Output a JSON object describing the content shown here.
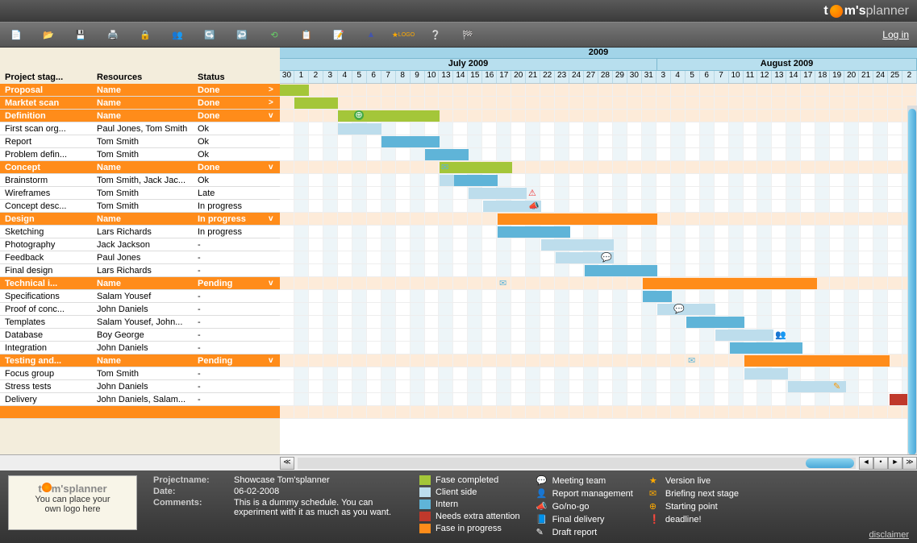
{
  "brand": {
    "t1": "t",
    "t2": "m's",
    "planner": "planner"
  },
  "login": "Log in",
  "toolbarStarLabel": "LOGO",
  "columns": {
    "stage": "Project stag...",
    "resources": "Resources",
    "status": "Status"
  },
  "year": "2009",
  "months": {
    "july": "July 2009",
    "august": "August 2009"
  },
  "days": [
    "30",
    "1",
    "2",
    "3",
    "4",
    "5",
    "6",
    "7",
    "8",
    "9",
    "10",
    "13",
    "14",
    "15",
    "16",
    "17",
    "20",
    "21",
    "22",
    "23",
    "24",
    "27",
    "28",
    "29",
    "30",
    "31",
    "3",
    "4",
    "5",
    "6",
    "7",
    "10",
    "11",
    "12",
    "13",
    "14",
    "17",
    "18",
    "19",
    "20",
    "21",
    "24",
    "25",
    "2"
  ],
  "rows": [
    {
      "phase": true,
      "stage": "Proposal",
      "res": "Name",
      "status": "Done",
      "chev": ">"
    },
    {
      "phase": true,
      "stage": "Marktet scan",
      "res": "Name",
      "status": "Done",
      "chev": ">"
    },
    {
      "phase": true,
      "stage": "Definition",
      "res": "Name",
      "status": "Done",
      "chev": "v"
    },
    {
      "stage": "First scan org...",
      "res": "Paul Jones, Tom Smith",
      "status": "Ok"
    },
    {
      "stage": "Report",
      "res": "Tom Smith",
      "status": "Ok"
    },
    {
      "stage": "Problem defin...",
      "res": "Tom Smith",
      "status": "Ok"
    },
    {
      "phase": true,
      "stage": "Concept",
      "res": "Name",
      "status": "Done",
      "chev": "v"
    },
    {
      "stage": "Brainstorm",
      "res": "Tom Smith, Jack Jac...",
      "status": "Ok"
    },
    {
      "stage": "Wireframes",
      "res": "Tom Smith",
      "status": "Late"
    },
    {
      "stage": "Concept desc...",
      "res": "Tom Smith",
      "status": "In progress"
    },
    {
      "phase": true,
      "stage": "Design",
      "res": "Name",
      "status": "In progress",
      "chev": "v"
    },
    {
      "stage": "Sketching",
      "res": "Lars Richards",
      "status": "In progress"
    },
    {
      "stage": "Photography",
      "res": "Jack Jackson",
      "status": "-"
    },
    {
      "stage": "Feedback",
      "res": "Paul Jones",
      "status": "-"
    },
    {
      "stage": "Final design",
      "res": "Lars Richards",
      "status": "-"
    },
    {
      "phase": true,
      "stage": "Technical i...",
      "res": "Name",
      "status": "Pending",
      "chev": "v"
    },
    {
      "stage": "Specifications",
      "res": "Salam Yousef",
      "status": "-"
    },
    {
      "stage": "Proof of conc...",
      "res": "John Daniels",
      "status": "-"
    },
    {
      "stage": "Templates",
      "res": "Salam Yousef, John...",
      "status": "-"
    },
    {
      "stage": "Database",
      "res": "Boy George",
      "status": "-"
    },
    {
      "stage": "Integration",
      "res": "John Daniels",
      "status": "-"
    },
    {
      "phase": true,
      "stage": "Testing and...",
      "res": "Name",
      "status": "Pending",
      "chev": "v"
    },
    {
      "stage": "Focus group",
      "res": "Tom Smith",
      "status": "-"
    },
    {
      "stage": "Stress tests",
      "res": "John Daniels",
      "status": "-"
    },
    {
      "stage": "Delivery",
      "res": "John Daniels, Salam...",
      "status": "-"
    },
    {
      "phase": true,
      "stage": "",
      "res": "",
      "status": "",
      "chev": ""
    }
  ],
  "bars": [
    {
      "row": 0,
      "col": 0,
      "span": 2,
      "cls": "green"
    },
    {
      "row": 1,
      "col": 1,
      "span": 3,
      "cls": "green"
    },
    {
      "row": 2,
      "col": 4,
      "span": 7,
      "cls": "green"
    },
    {
      "row": 3,
      "col": 4,
      "span": 3,
      "cls": "lblue"
    },
    {
      "row": 4,
      "col": 7,
      "span": 4,
      "cls": "blue"
    },
    {
      "row": 5,
      "col": 10,
      "span": 3,
      "cls": "blue"
    },
    {
      "row": 6,
      "col": 11,
      "span": 5,
      "cls": "green"
    },
    {
      "row": 7,
      "col": 11,
      "span": 1,
      "cls": "lblue"
    },
    {
      "row": 7,
      "col": 12,
      "span": 3,
      "cls": "blue"
    },
    {
      "row": 8,
      "col": 13,
      "span": 4,
      "cls": "lblue"
    },
    {
      "row": 9,
      "col": 14,
      "span": 4,
      "cls": "lblue"
    },
    {
      "row": 10,
      "col": 15,
      "span": 11,
      "cls": "orange"
    },
    {
      "row": 11,
      "col": 15,
      "span": 5,
      "cls": "blue"
    },
    {
      "row": 12,
      "col": 18,
      "span": 5,
      "cls": "lblue"
    },
    {
      "row": 13,
      "col": 19,
      "span": 4,
      "cls": "lblue"
    },
    {
      "row": 14,
      "col": 21,
      "span": 5,
      "cls": "blue"
    },
    {
      "row": 15,
      "col": 25,
      "span": 12,
      "cls": "orange"
    },
    {
      "row": 16,
      "col": 25,
      "span": 2,
      "cls": "blue"
    },
    {
      "row": 17,
      "col": 26,
      "span": 4,
      "cls": "lblue"
    },
    {
      "row": 18,
      "col": 28,
      "span": 4,
      "cls": "blue"
    },
    {
      "row": 19,
      "col": 30,
      "span": 4,
      "cls": "lblue"
    },
    {
      "row": 20,
      "col": 31,
      "span": 5,
      "cls": "blue"
    },
    {
      "row": 21,
      "col": 32,
      "span": 10,
      "cls": "orange"
    },
    {
      "row": 22,
      "col": 32,
      "span": 3,
      "cls": "lblue"
    },
    {
      "row": 23,
      "col": 35,
      "span": 4,
      "cls": "lblue"
    },
    {
      "row": 24,
      "col": 42,
      "span": 2,
      "cls": "red"
    }
  ],
  "icons": [
    {
      "row": 2,
      "col": 5,
      "glyph": "⊕",
      "color": "#fff",
      "bg": "#4a4"
    },
    {
      "row": 6,
      "col": 11,
      "glyph": "✉",
      "color": "#5fb4d8"
    },
    {
      "row": 8,
      "col": 17,
      "glyph": "⚠",
      "color": "#e33"
    },
    {
      "row": 9,
      "col": 17,
      "glyph": "📣",
      "color": "#f90"
    },
    {
      "row": 13,
      "col": 22,
      "glyph": "💬",
      "color": "#5fb4d8"
    },
    {
      "row": 15,
      "col": 15,
      "glyph": "✉",
      "color": "#5fb4d8"
    },
    {
      "row": 17,
      "col": 27,
      "glyph": "💬",
      "color": "#5fb4d8"
    },
    {
      "row": 19,
      "col": 34,
      "glyph": "👥",
      "color": "#f90"
    },
    {
      "row": 21,
      "col": 28,
      "glyph": "✉",
      "color": "#5fb4d8"
    },
    {
      "row": 23,
      "col": 38,
      "glyph": "✎",
      "color": "#f90"
    }
  ],
  "logoBox": {
    "logo": "t🟠m'splanner",
    "line1": "You can place your",
    "line2": "own logo here"
  },
  "meta": {
    "lbl_name": "Projectname:",
    "val_name": "Showcase Tom'splanner",
    "lbl_date": "Date:",
    "val_date": "06-02-2008",
    "lbl_comm": "Comments:",
    "val_comm": "This is a dummy schedule. You can experiment with it as much as you want."
  },
  "legend": {
    "col1": [
      {
        "sw": "green",
        "t": "Fase completed"
      },
      {
        "sw": "lblue",
        "t": "Client side"
      },
      {
        "sw": "blue",
        "t": "Intern"
      },
      {
        "sw": "red",
        "t": "Needs extra attention"
      },
      {
        "sw": "orange",
        "t": "Fase in progress"
      }
    ],
    "col2": [
      {
        "g": "💬",
        "t": "Meeting team"
      },
      {
        "g": "👤",
        "t": "Report management"
      },
      {
        "g": "📣",
        "t": "Go/no-go"
      },
      {
        "g": "📘",
        "t": "Final delivery"
      },
      {
        "g": "✎",
        "t": "Draft report"
      }
    ],
    "col3": [
      {
        "g": "★",
        "t": "Version live"
      },
      {
        "g": "✉",
        "t": "Briefing next stage"
      },
      {
        "g": "⊕",
        "t": "Starting point"
      },
      {
        "g": "❗",
        "t": "deadline!"
      }
    ]
  },
  "disclaimer": "disclaimer"
}
